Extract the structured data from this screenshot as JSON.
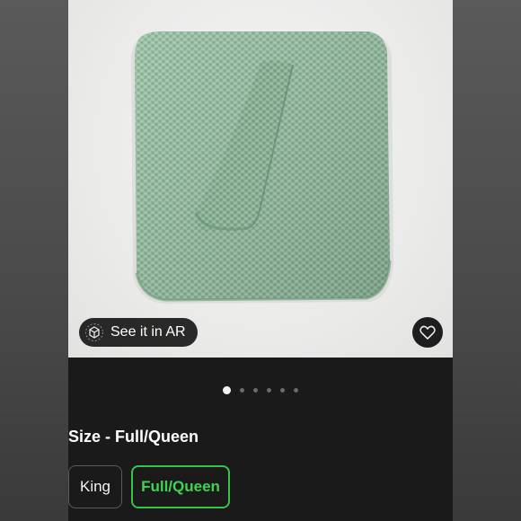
{
  "ar_button": {
    "label": "See it in AR"
  },
  "carousel": {
    "total": 6,
    "active_index": 1
  },
  "size": {
    "prefix": "Size - ",
    "selected": "Full/Queen",
    "options": [
      {
        "label": "King",
        "selected": false
      },
      {
        "label": "Full/Queen",
        "selected": true
      }
    ]
  },
  "colors": {
    "accent": "#37c24a",
    "blanket": "#8fb79c",
    "background": "#1a1a1a"
  },
  "icons": {
    "ar": "ar-cube-icon",
    "favorite": "heart-icon"
  }
}
